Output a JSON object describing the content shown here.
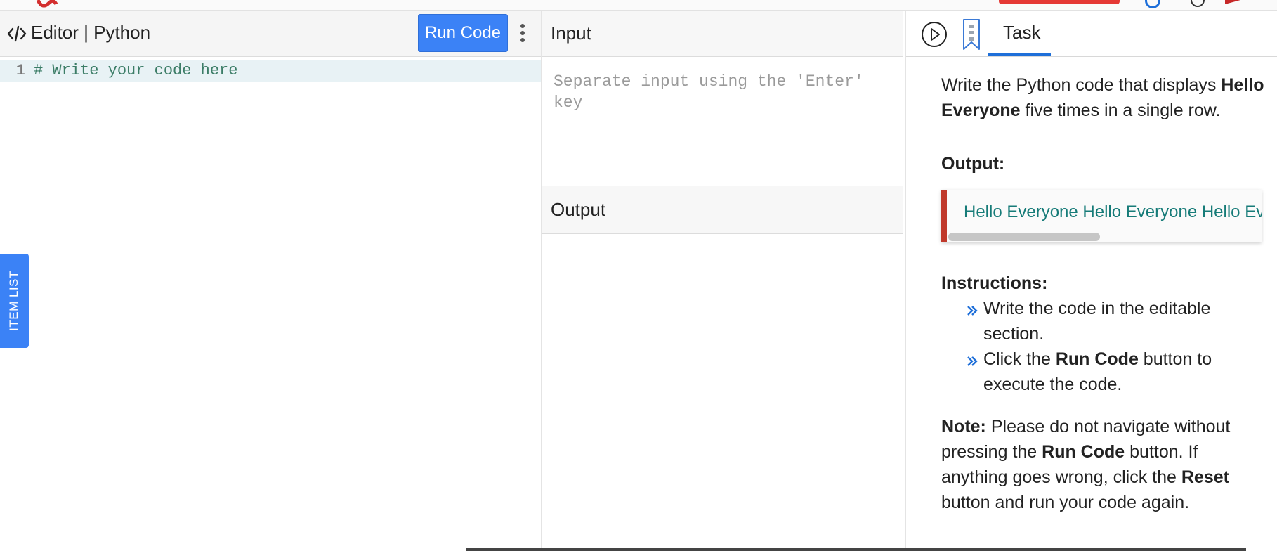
{
  "editor": {
    "title": "Editor | Python",
    "run_label": "Run Code",
    "code_lines": [
      {
        "num": "1",
        "text": "# Write your code here"
      }
    ],
    "item_list_label": "ITEM LIST"
  },
  "io": {
    "input_title": "Input",
    "input_placeholder": "Separate input using the 'Enter' key",
    "output_title": "Output"
  },
  "task": {
    "tab_label": "Task",
    "description": {
      "p1": "Write the Python code that displays ",
      "b1": "Hello Everyone",
      "p2": " five times in a single row."
    },
    "output_heading": "Output:",
    "output_sample": "Hello Everyone Hello Everyone Hello Everyone Hello Everyone Hello Everyone",
    "instructions_heading": "Instructions:",
    "instructions": [
      {
        "text": "Write the code in the editable section."
      },
      {
        "pre": "Click the ",
        "bold": "Run Code",
        "post": " button to execute the code."
      }
    ],
    "note": {
      "label": "Note:",
      "t1": " Please do not navigate without pressing the ",
      "b1": "Run Code",
      "t2": " button. If anything goes wrong, click the ",
      "b2": "Reset",
      "t3": " button and run your code again."
    }
  },
  "colors": {
    "accent": "#3b82f6",
    "tab_underline": "#1e6fd9",
    "output_border": "#c0392b",
    "output_text": "#167b78",
    "code_comment": "#3c7d67"
  }
}
